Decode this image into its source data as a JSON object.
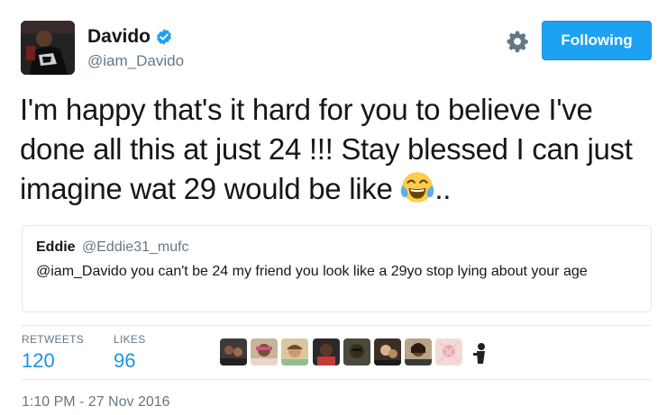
{
  "author": {
    "name": "Davido",
    "handle": "@iam_Davido",
    "verified_icon": "verified-badge-icon"
  },
  "actions": {
    "settings_icon": "gear-icon",
    "follow_label": "Following"
  },
  "tweet": {
    "text": "I'm happy that's it hard for you to believe I've done all this at just 24 !!! Stay blessed I can just imagine wat 29 would be like",
    "emoji": "face-with-tears-of-joy",
    "suffix": ".."
  },
  "quote": {
    "name": "Eddie",
    "handle": "@Eddie31_mufc",
    "text": "@iam_Davido you can't be 24 my friend you look like a 29yo stop lying about your age"
  },
  "stats": {
    "retweets_label": "RETWEETS",
    "retweets_value": "120",
    "likes_label": "LIKES",
    "likes_value": "96"
  },
  "timestamp": "1:10 PM - 27 Nov 2016",
  "colors": {
    "accent": "#1da1f2",
    "stat_value": "#1b95e0",
    "muted": "#657786"
  }
}
